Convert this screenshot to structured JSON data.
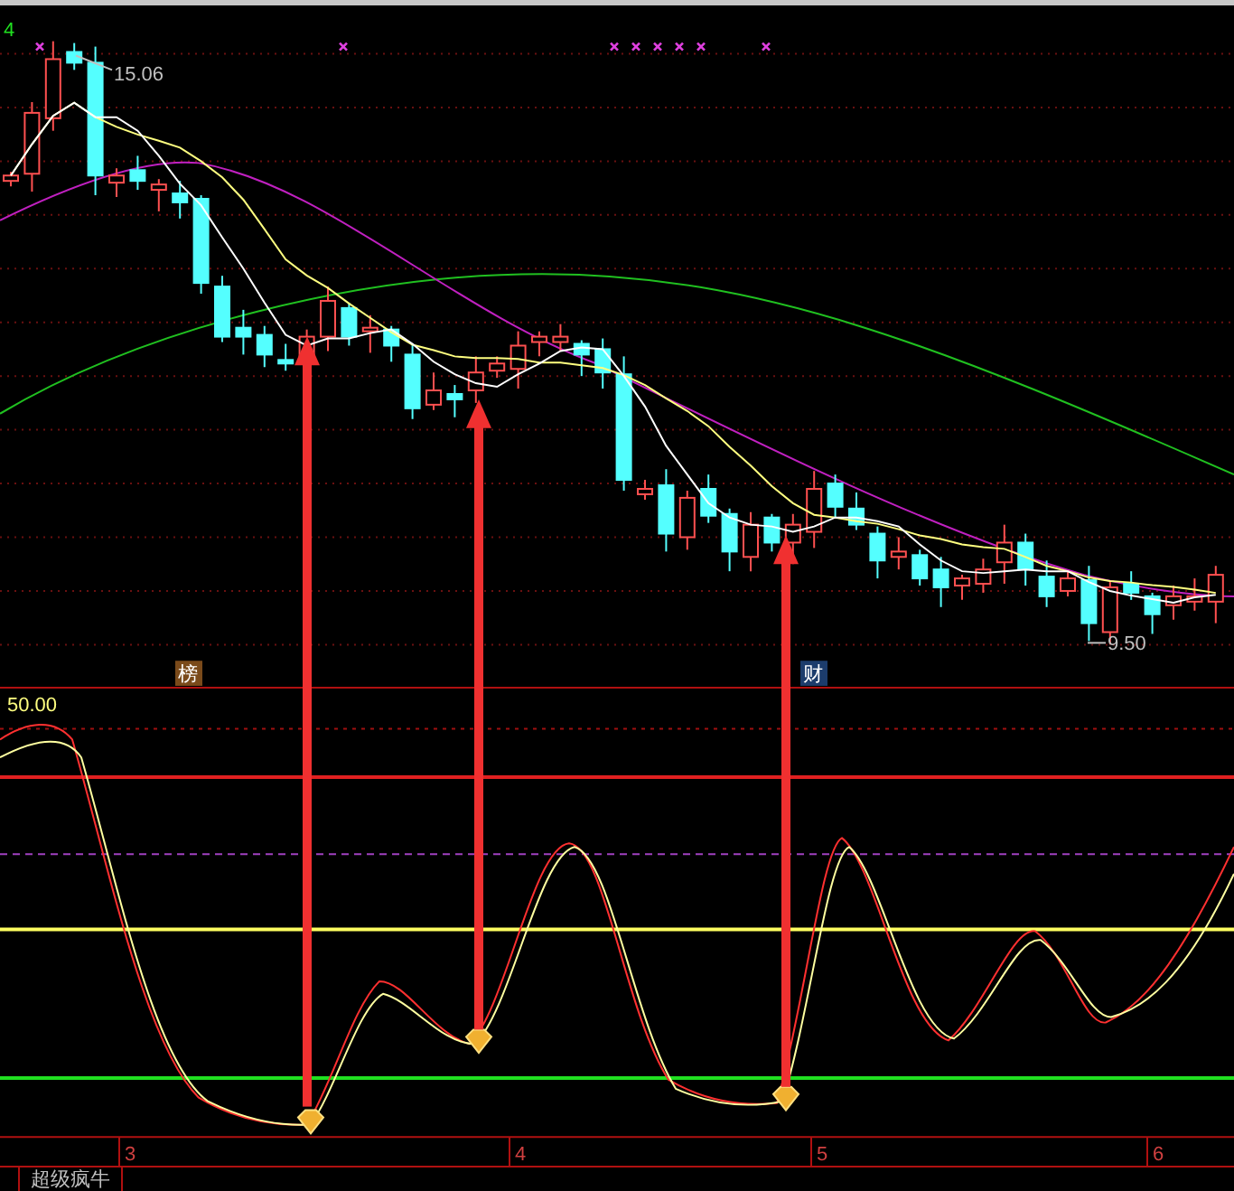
{
  "period_label": "4",
  "price_chart": {
    "high_label": "15.06",
    "low_label": "9.50",
    "signals": [
      {
        "text": "榜",
        "color": "#7a4a1a"
      },
      {
        "text": "财",
        "color": "#1c3c6c"
      }
    ]
  },
  "indicator": {
    "value_label": "50.00"
  },
  "time_axis": {
    "labels": [
      "3",
      "4",
      "5",
      "6"
    ]
  },
  "tabs": [
    {
      "label": "超级疯牛"
    }
  ]
}
